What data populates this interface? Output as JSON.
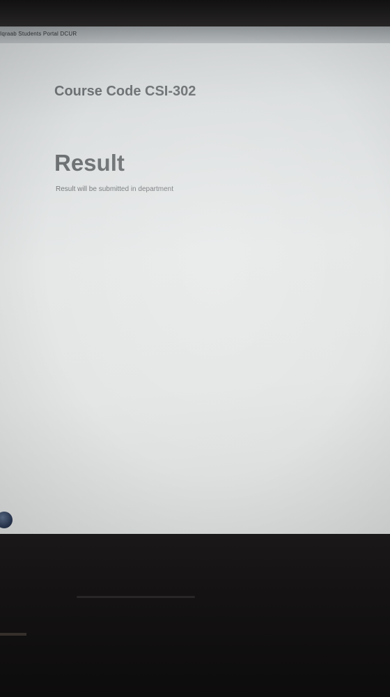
{
  "browser": {
    "page_title": "Iqraab Students Portal DCUR"
  },
  "main": {
    "course_code": "Course Code CSI-302",
    "result_heading": "Result",
    "result_text": "Result will be submitted in department"
  },
  "icons": {
    "corner_icon": "start-orb-icon"
  }
}
